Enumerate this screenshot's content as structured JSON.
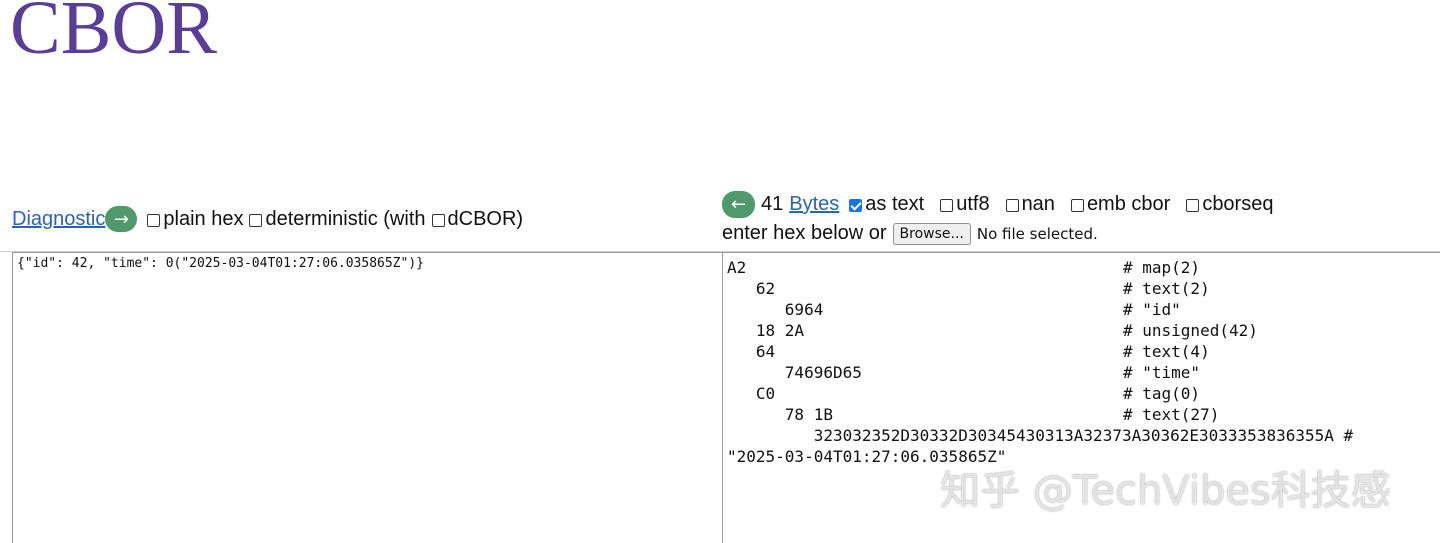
{
  "logo": "CBOR",
  "left_toolbar": {
    "diagnostic_label": "Diagnostic",
    "to_right_arrow": "→",
    "options": [
      {
        "label": "plain hex",
        "checked": false
      },
      {
        "label": "deterministic (with",
        "checked": false
      },
      {
        "label": "dCBOR)",
        "checked": false
      }
    ]
  },
  "right_toolbar": {
    "to_left_arrow": "←",
    "byte_count": "41",
    "bytes_label": "Bytes",
    "options": [
      {
        "label": "as text",
        "checked": true
      },
      {
        "label": "utf8",
        "checked": false
      },
      {
        "label": "nan",
        "checked": false
      },
      {
        "label": "emb cbor",
        "checked": false
      },
      {
        "label": "cborseq",
        "checked": false
      }
    ],
    "enter_hex_text": "enter hex below or",
    "browse_label": "Browse...",
    "file_status": "No file selected."
  },
  "diagnostic_text": "{\"id\": 42, \"time\": 0(\"2025-03-04T01:27:06.035865Z\")}",
  "hex_dump": [
    {
      "hex": "A2",
      "comment": "# map(2)"
    },
    {
      "hex": "   62",
      "comment": "# text(2)"
    },
    {
      "hex": "      6964",
      "comment": "# \"id\""
    },
    {
      "hex": "   18 2A",
      "comment": "# unsigned(42)"
    },
    {
      "hex": "   64",
      "comment": "# text(4)"
    },
    {
      "hex": "      74696D65",
      "comment": "# \"time\""
    },
    {
      "hex": "   C0",
      "comment": "# tag(0)"
    },
    {
      "hex": "      78 1B",
      "comment": "# text(27)"
    }
  ],
  "hex_wrap_line": "         323032352D30332D30345430313A32373A30362E3033353836355A #\n\"2025-03-04T01:27:06.035865Z\"",
  "watermark": "知乎 @TechVibes科技感"
}
